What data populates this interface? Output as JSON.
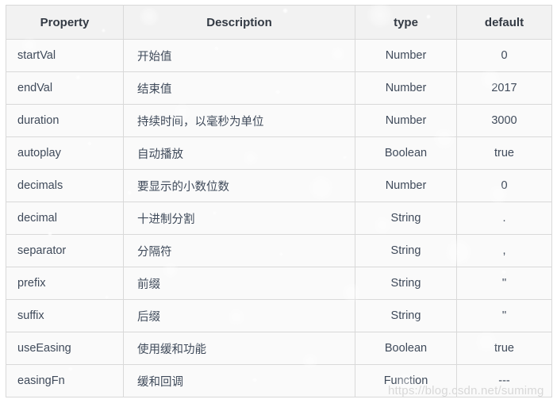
{
  "table": {
    "name": "countup-options-table",
    "columns": [
      {
        "key": "property",
        "label": "Property",
        "align": "left"
      },
      {
        "key": "description",
        "label": "Description",
        "align": "left"
      },
      {
        "key": "type",
        "label": "type",
        "align": "center"
      },
      {
        "key": "default",
        "label": "default",
        "align": "center"
      }
    ],
    "rows": [
      {
        "property": "startVal",
        "description": "开始值",
        "type": "Number",
        "default": "0"
      },
      {
        "property": "endVal",
        "description": "结束值",
        "type": "Number",
        "default": "2017"
      },
      {
        "property": "duration",
        "description": "持续时间，以毫秒为单位",
        "type": "Number",
        "default": "3000"
      },
      {
        "property": "autoplay",
        "description": "自动播放",
        "type": "Boolean",
        "default": "true"
      },
      {
        "property": "decimals",
        "description": "要显示的小数位数",
        "type": "Number",
        "default": "0"
      },
      {
        "property": "decimal",
        "description": "十进制分割",
        "type": "String",
        "default": "."
      },
      {
        "property": "separator",
        "description": "分隔符",
        "type": "String",
        "default": ","
      },
      {
        "property": "prefix",
        "description": "前缀",
        "type": "String",
        "default": "''"
      },
      {
        "property": "suffix",
        "description": "后缀",
        "type": "String",
        "default": "''"
      },
      {
        "property": "useEasing",
        "description": "使用缓和功能",
        "type": "Boolean",
        "default": "true"
      },
      {
        "property": "easingFn",
        "description": "缓和回调",
        "type": "Function",
        "default": "---"
      }
    ]
  },
  "watermark": {
    "text": "https://blog.csdn.net/sumimg"
  },
  "colors": {
    "header_background": "#f2f2f2",
    "cell_background": "#fafafa",
    "border": "#d9d9d9",
    "text": "#3f4a5a",
    "watermark": "#d8d8d8"
  }
}
